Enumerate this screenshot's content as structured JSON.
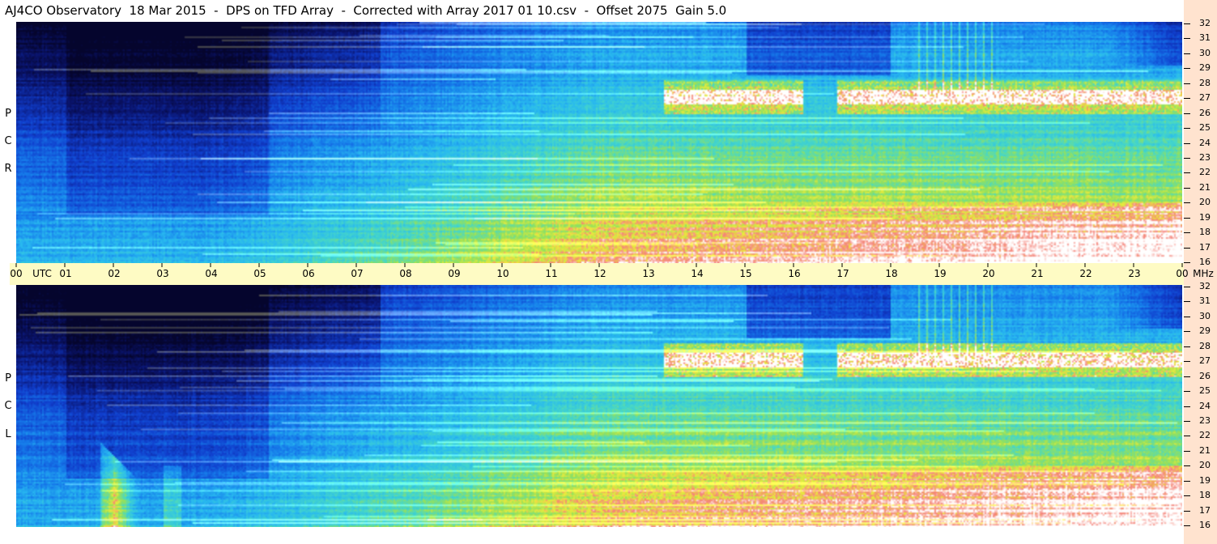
{
  "title": "AJ4CO Observatory  18 Mar 2015  -  DPS on TFD Array  -  Corrected with Array 2017 01 10.csv  -  Offset 2075  Gain 5.0",
  "top_panel": {
    "polarization_label": [
      "R",
      "C",
      "P"
    ]
  },
  "bottom_panel": {
    "polarization_label": [
      "L",
      "C",
      "P"
    ]
  },
  "time_axis": {
    "labels": [
      "00",
      "UTC",
      "01",
      "02",
      "03",
      "04",
      "05",
      "06",
      "07",
      "08",
      "09",
      "10",
      "11",
      "12",
      "13",
      "14",
      "15",
      "16",
      "17",
      "18",
      "19",
      "20",
      "21",
      "22",
      "23",
      "00",
      "MHz"
    ]
  },
  "freq_axis": {
    "top_labels": [
      "32",
      "31",
      "30",
      "29",
      "28",
      "27",
      "26",
      "25",
      "24",
      "23",
      "22",
      "21",
      "20",
      "19",
      "18",
      "17",
      "16"
    ],
    "bottom_labels": [
      "32",
      "31",
      "30",
      "29",
      "28",
      "27",
      "26",
      "25",
      "24",
      "23",
      "22",
      "21",
      "20",
      "19",
      "18",
      "17",
      "16"
    ]
  },
  "colors": {
    "strip_time": "#fefbc4",
    "strip_freq": "#ffe3cf"
  }
}
